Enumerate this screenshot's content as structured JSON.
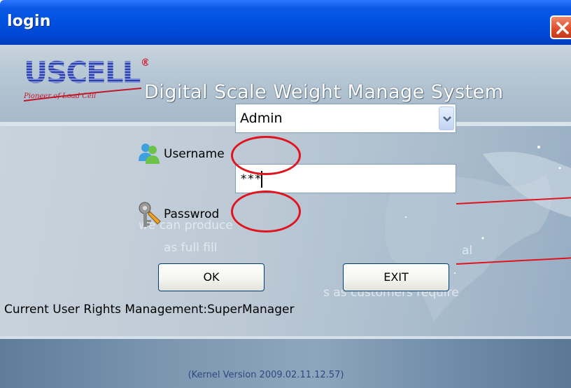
{
  "window": {
    "title": "login",
    "close_icon": "close-icon"
  },
  "banner": {
    "logo_text": "USCELL",
    "logo_tagline": "Pioneer of Load Cell",
    "logo_mark": "®",
    "app_title": "Digital Scale Weight Manage System"
  },
  "form": {
    "username_label": "Username",
    "username_value": "Admin",
    "username_icon": "users-icon",
    "password_label": "Passwrod",
    "password_value": "***",
    "password_icon": "key-icon"
  },
  "buttons": {
    "ok_label": "OK",
    "exit_label": "EXIT"
  },
  "status": {
    "rights_text": "Current User Rights Management:SuperManager"
  },
  "background_text": {
    "line1": "we can produce",
    "line2": "as full fill",
    "line3": "al",
    "line4": "s as customers require"
  },
  "footer": {
    "version_text": "(Kernel Version 2009.02.11.12.57)"
  },
  "colors": {
    "titlebar": "#0050e0",
    "annotation": "#e0141e",
    "close": "#dc4a2a"
  }
}
